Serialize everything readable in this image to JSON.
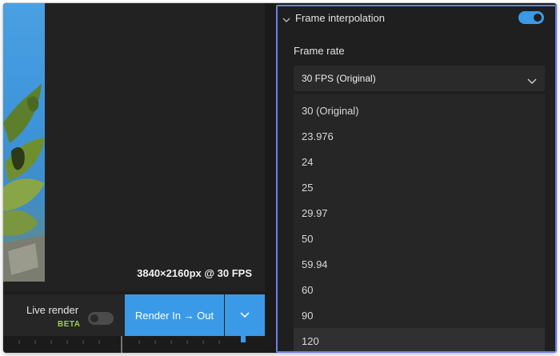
{
  "preview": {
    "resolution": "3840×2160px @ 30 FPS"
  },
  "controls": {
    "live_render_label": "Live render",
    "beta_badge": "BETA",
    "render_button": "Render In → Out"
  },
  "panel": {
    "section_title": "Frame interpolation",
    "frame_rate_label": "Frame rate",
    "selected_value": "30 FPS (Original)",
    "options": [
      "30 (Original)",
      "23.976",
      "24",
      "25",
      "29.97",
      "50",
      "59.94",
      "60",
      "90",
      "120"
    ]
  },
  "colors": {
    "accent": "#3b9ae8",
    "beta": "#9ad14a",
    "panel_border": "#6b7fe8"
  },
  "icons": {
    "section_caret": "chevron-down-icon",
    "select_chevron": "chevron-down-icon",
    "render_drop": "chevron-down-icon"
  }
}
